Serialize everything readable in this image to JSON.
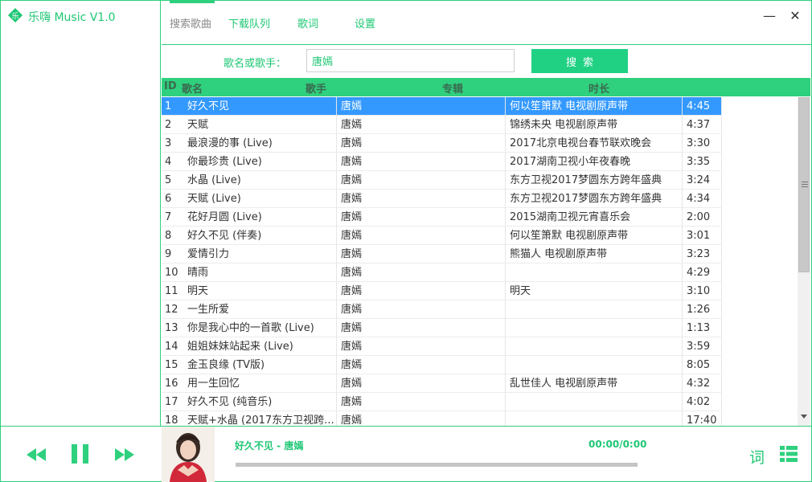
{
  "app": {
    "title": "乐嗨 Music V1.0"
  },
  "tabs": [
    {
      "label": "搜索歌曲"
    },
    {
      "label": "下载队列"
    },
    {
      "label": "歌词"
    },
    {
      "label": "设置"
    }
  ],
  "window": {
    "minimize": "—",
    "close": "✕"
  },
  "search": {
    "label": "歌名或歌手：",
    "value": "唐嫣",
    "button": "搜索"
  },
  "table": {
    "columns": [
      "ID",
      "歌名",
      "歌手",
      "专辑",
      "时长"
    ],
    "rows": [
      {
        "id": "1",
        "name": "好久不见",
        "singer": "唐嫣",
        "album": "何以笙箫默 电视剧原声带",
        "duration": "4:45"
      },
      {
        "id": "2",
        "name": "天赋",
        "singer": "唐嫣",
        "album": "锦绣未央 电视剧原声带",
        "duration": "4:37"
      },
      {
        "id": "3",
        "name": "最浪漫的事 (Live)",
        "singer": "唐嫣",
        "album": "2017北京电视台春节联欢晚会",
        "duration": "3:30"
      },
      {
        "id": "4",
        "name": "你最珍贵 (Live)",
        "singer": "唐嫣",
        "album": "2017湖南卫视小年夜春晚",
        "duration": "3:35"
      },
      {
        "id": "5",
        "name": "水晶 (Live)",
        "singer": "唐嫣",
        "album": "东方卫视2017梦圆东方跨年盛典",
        "duration": "3:24"
      },
      {
        "id": "6",
        "name": "天赋 (Live)",
        "singer": "唐嫣",
        "album": "东方卫视2017梦圆东方跨年盛典",
        "duration": "4:34"
      },
      {
        "id": "7",
        "name": "花好月圆 (Live)",
        "singer": "唐嫣",
        "album": "2015湖南卫视元宵喜乐会",
        "duration": "2:00"
      },
      {
        "id": "8",
        "name": "好久不见 (伴奏)",
        "singer": "唐嫣",
        "album": "何以笙箫默 电视剧原声带",
        "duration": "3:01"
      },
      {
        "id": "9",
        "name": "爱情引力",
        "singer": "唐嫣",
        "album": "熊猫人 电视剧原声带",
        "duration": "3:23"
      },
      {
        "id": "10",
        "name": "晴雨",
        "singer": "唐嫣",
        "album": "",
        "duration": "4:29"
      },
      {
        "id": "11",
        "name": "明天",
        "singer": "唐嫣",
        "album": "明天",
        "duration": "3:10"
      },
      {
        "id": "12",
        "name": "一生所爱",
        "singer": "唐嫣",
        "album": "",
        "duration": "1:26"
      },
      {
        "id": "13",
        "name": "你是我心中的一首歌 (Live)",
        "singer": "唐嫣",
        "album": "",
        "duration": "1:13"
      },
      {
        "id": "14",
        "name": "姐姐妹妹站起来 (Live)",
        "singer": "唐嫣",
        "album": "",
        "duration": "3:59"
      },
      {
        "id": "15",
        "name": "金玉良缘 (TV版)",
        "singer": "唐嫣",
        "album": "",
        "duration": "8:05"
      },
      {
        "id": "16",
        "name": "用一生回忆",
        "singer": "唐嫣",
        "album": "乱世佳人 电视剧原声带",
        "duration": "4:32"
      },
      {
        "id": "17",
        "name": "好久不见 (纯音乐)",
        "singer": "唐嫣",
        "album": "",
        "duration": "4:02"
      },
      {
        "id": "18",
        "name": "天赋+水晶 (2017东方卫视跨...",
        "singer": "唐嫣",
        "album": "",
        "duration": "17:40"
      }
    ]
  },
  "player": {
    "now_playing": "好久不见 - 唐嫣",
    "time": "00:00/0:00",
    "progress": 0,
    "lyric_button": "词"
  },
  "colors": {
    "accent": "#2fd07e",
    "accent_text": "#1fc774",
    "selected_row": "#3399ff"
  },
  "icons": {
    "logo": "leaf-note-logo-icon",
    "prev": "rewind-icon",
    "pause": "pause-icon",
    "next": "fast-forward-icon",
    "list": "grid-list-icon"
  }
}
